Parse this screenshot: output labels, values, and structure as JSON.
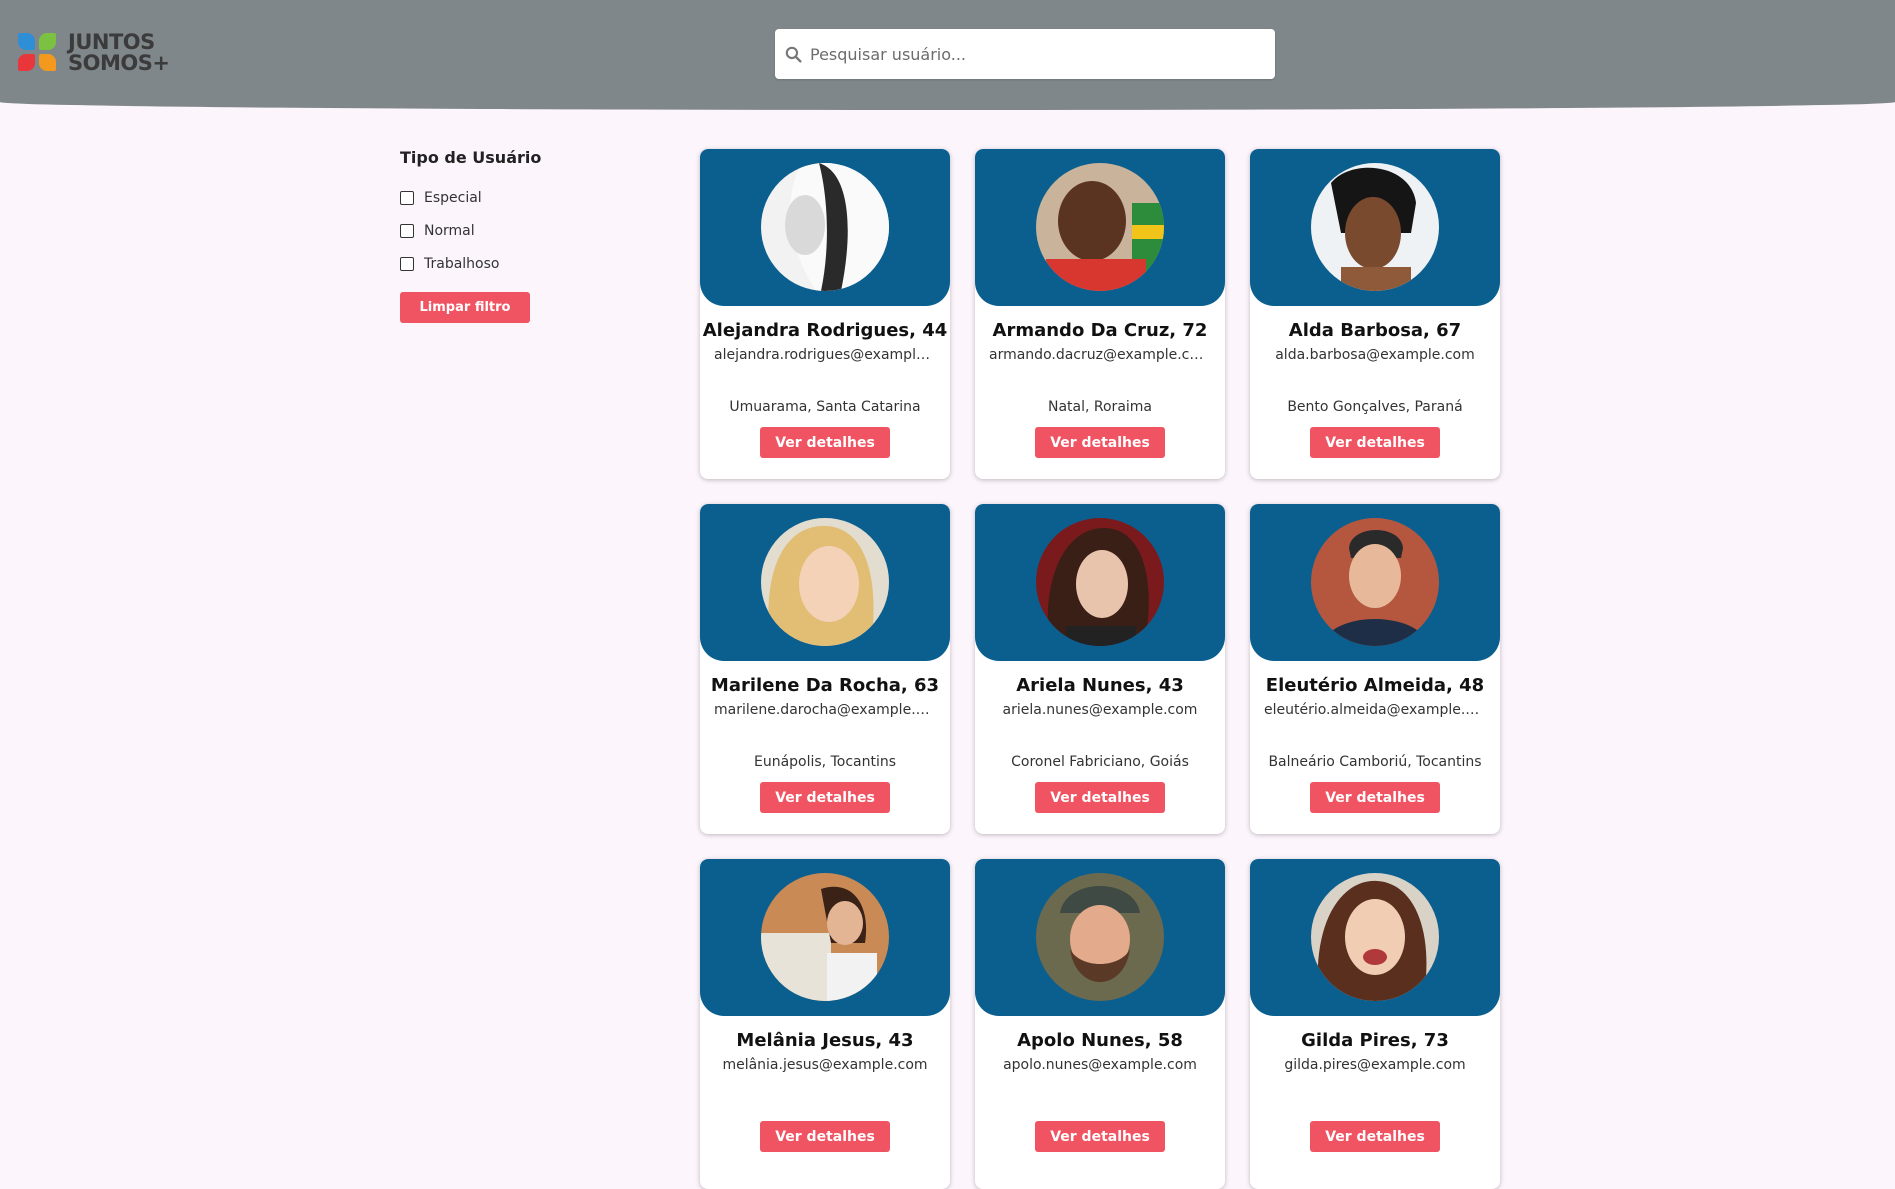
{
  "header": {
    "logo": {
      "line1": "JUNTOS",
      "line2": "SOMOS+"
    },
    "search": {
      "placeholder": "Pesquisar usuário..."
    }
  },
  "sidebar": {
    "title": "Tipo de Usuário",
    "options": [
      "Especial",
      "Normal",
      "Trabalhoso"
    ],
    "clear_label": "Limpar filtro"
  },
  "users": [
    {
      "name": "Alejandra Rodrigues, 44",
      "email": "alejandra.rodrigues@example.com",
      "city": "Umuarama, Santa Catarina",
      "button": "Ver detalhes"
    },
    {
      "name": "Armando Da Cruz, 72",
      "email": "armando.dacruz@example.com",
      "city": "Natal, Roraima",
      "button": "Ver detalhes"
    },
    {
      "name": "Alda Barbosa, 67",
      "email": "alda.barbosa@example.com",
      "city": "Bento Gonçalves, Paraná",
      "button": "Ver detalhes"
    },
    {
      "name": "Marilene Da Rocha, 63",
      "email": "marilene.darocha@example.com",
      "city": "Eunápolis, Tocantins",
      "button": "Ver detalhes"
    },
    {
      "name": "Ariela Nunes, 43",
      "email": "ariela.nunes@example.com",
      "city": "Coronel Fabriciano, Goiás",
      "button": "Ver detalhes"
    },
    {
      "name": "Eleutério Almeida, 48",
      "email": "eleutério.almeida@example.com",
      "city": "Balneário Camboriú, Tocantins",
      "button": "Ver detalhes"
    },
    {
      "name": "Melânia Jesus, 43",
      "email": "melânia.jesus@example.com",
      "city": "",
      "button": "Ver detalhes"
    },
    {
      "name": "Apolo Nunes, 58",
      "email": "apolo.nunes@example.com",
      "city": "",
      "button": "Ver detalhes"
    },
    {
      "name": "Gilda Pires, 73",
      "email": "gilda.pires@example.com",
      "city": "",
      "button": "Ver detalhes"
    }
  ],
  "colors": {
    "header_bg": "#7f878b",
    "card_top": "#0b5f8f",
    "accent": "#f05462",
    "page_bg": "#fcf5fc"
  }
}
